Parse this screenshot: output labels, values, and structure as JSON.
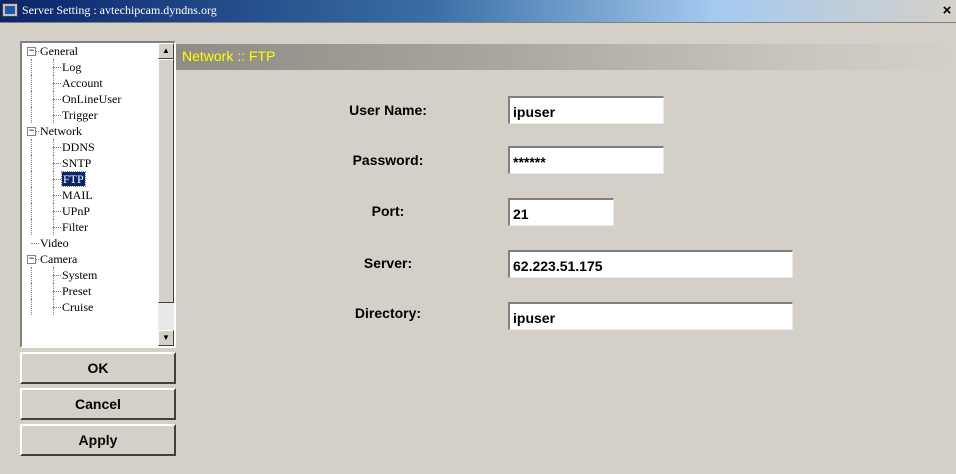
{
  "window": {
    "title": "Server Setting : avtechipcam.dyndns.org",
    "close_label": "×"
  },
  "tree": {
    "items": [
      {
        "label": "General",
        "level": 0,
        "expander": "−"
      },
      {
        "label": "Log",
        "level": 1
      },
      {
        "label": "Account",
        "level": 1
      },
      {
        "label": "OnLineUser",
        "level": 1
      },
      {
        "label": "Trigger",
        "level": 1
      },
      {
        "label": "Network",
        "level": 0,
        "expander": "−"
      },
      {
        "label": "DDNS",
        "level": 1
      },
      {
        "label": "SNTP",
        "level": 1
      },
      {
        "label": "FTP",
        "level": 1,
        "selected": true
      },
      {
        "label": "MAIL",
        "level": 1
      },
      {
        "label": "UPnP",
        "level": 1
      },
      {
        "label": "Filter",
        "level": 1
      },
      {
        "label": "Video",
        "level": 0
      },
      {
        "label": "Camera",
        "level": 0,
        "expander": "−"
      },
      {
        "label": "System",
        "level": 1
      },
      {
        "label": "Preset",
        "level": 1
      },
      {
        "label": "Cruise",
        "level": 1
      }
    ],
    "scroll_up": "▲",
    "scroll_down": "▼"
  },
  "buttons": {
    "ok": "OK",
    "cancel": "Cancel",
    "apply": "Apply"
  },
  "section": {
    "title": "Network :: FTP"
  },
  "form": {
    "user_name_label": "User Name:",
    "user_name_value": "ipuser",
    "password_label": "Password:",
    "password_value": "******",
    "port_label": "Port:",
    "port_value": "21",
    "server_label": "Server:",
    "server_value": "62.223.51.175",
    "directory_label": "Directory:",
    "directory_value": "ipuser"
  },
  "colors": {
    "titlebar": "#0a246a",
    "section_title": "#ffff00",
    "dialog_bg": "#d4d0c8"
  }
}
